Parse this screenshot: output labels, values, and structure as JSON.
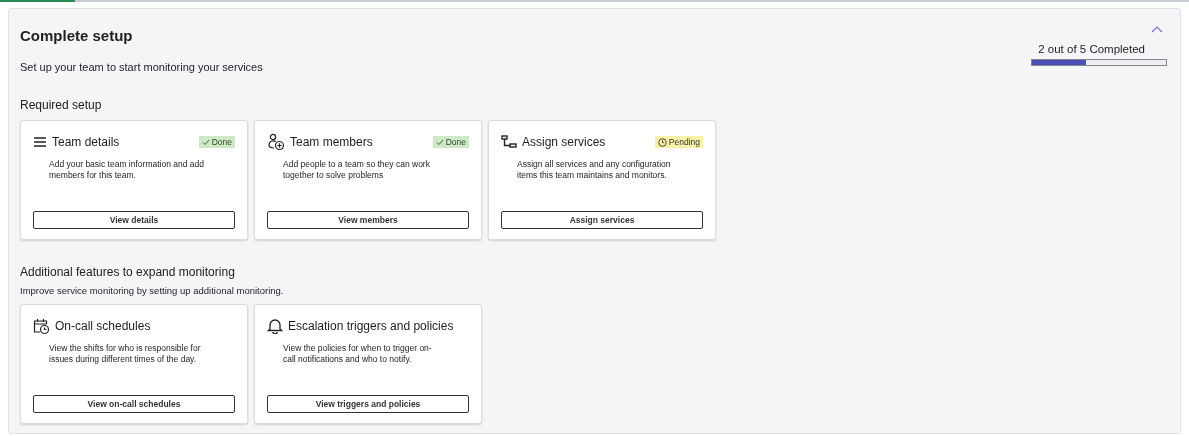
{
  "top_loader": {
    "level": 0.063
  },
  "panel": {
    "title": "Complete setup",
    "subtitle": "Set up your team to start monitoring your services",
    "expanded": true,
    "progress": {
      "label": "2 out of 5 Completed",
      "level": 0.4
    }
  },
  "sections": [
    {
      "title": "Required setup",
      "cards": [
        {
          "kind": "list",
          "title": "Team details",
          "status": {
            "kind": "done",
            "label": "Done"
          },
          "description": "Add your basic team information and add members for this team.",
          "button": "View details"
        },
        {
          "kind": "people",
          "title": "Team members",
          "status": {
            "kind": "done",
            "label": "Done"
          },
          "description": "Add people to a team so they can work together to solve problems",
          "button": "View members"
        },
        {
          "kind": "services",
          "title": "Assign services",
          "status": {
            "kind": "pending",
            "label": "Pending"
          },
          "description": "Assign all services and any configuration items this team maintains and monitors.",
          "button": "Assign services"
        }
      ]
    },
    {
      "title": "Additional features to expand monitoring",
      "description": "Improve service monitoring by setting up additional monitoring.",
      "cards": [
        {
          "kind": "schedule",
          "title": "On-call schedules",
          "description": "View the shifts for who is responsible for issues during different times of the day.",
          "button": "View on-call schedules"
        },
        {
          "kind": "alert",
          "title": "Escalation triggers and policies",
          "description": "View the policies for when to trigger on-call notifications and who to notify.",
          "button": "View triggers and policies"
        }
      ]
    }
  ]
}
